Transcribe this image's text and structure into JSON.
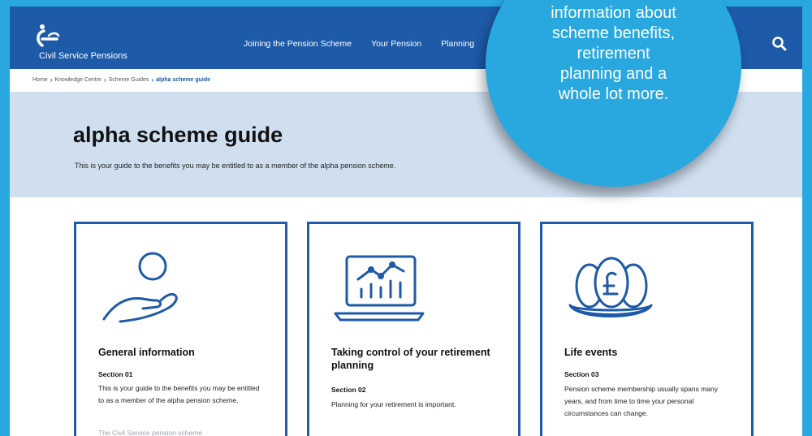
{
  "header": {
    "logo_text": "Civil Service Pensions",
    "nav": [
      "Joining the Pension Scheme",
      "Your Pension",
      "Planning"
    ]
  },
  "breadcrumb": [
    "Home",
    "Knowledge Centre",
    "Scheme Guides",
    "alpha scheme guide"
  ],
  "hero": {
    "title": "alpha scheme guide",
    "intro": "This is your guide to the benefits you may be entitled to as a member of the alpha pension scheme."
  },
  "cards": [
    {
      "title": "General information",
      "section": "Section 01",
      "text": "This is your guide to the benefits you may be entitled to as a member of the alpha pension scheme.",
      "more": "The Civil Service pension scheme"
    },
    {
      "title": "Taking control of your retirement planning",
      "section": "Section 02",
      "text": "Planning for your retirement is important."
    },
    {
      "title": "Life events",
      "section": "Section 03",
      "text": "Pension scheme membership usually spans many years, and from time to time your personal circumstances can change."
    }
  ],
  "callout": {
    "lines": [
      "information about",
      "scheme benefits,",
      "retirement",
      "planning and a",
      "whole lot more."
    ]
  },
  "colors": {
    "brand_blue": "#1d5aa8",
    "callout_blue": "#29a8e0",
    "hero_bg": "#cfdff0"
  }
}
